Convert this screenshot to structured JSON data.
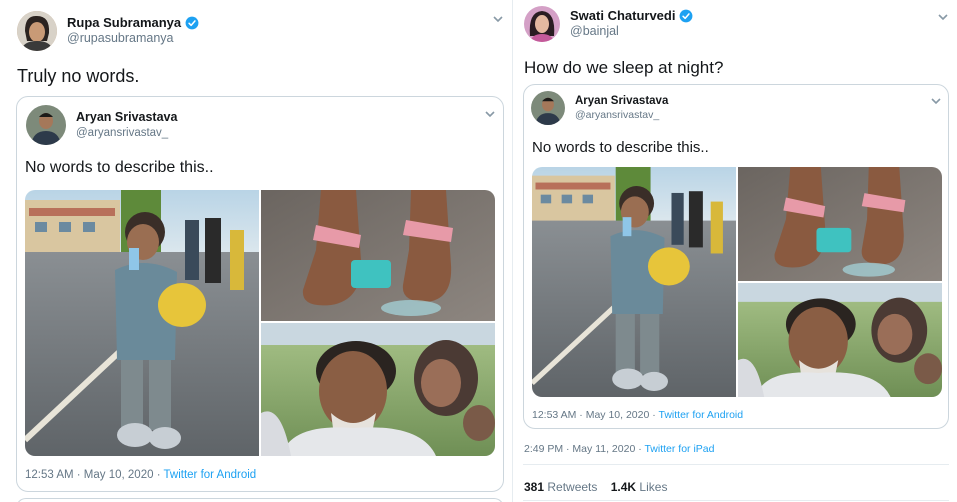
{
  "left_tweet": {
    "author_name": "Rupa Subramanya",
    "author_handle": "@rupasubramanya",
    "text": "Truly no words.",
    "quoted": {
      "author_name": "Aryan Srivastava",
      "author_handle": "@aryansrivastav_",
      "text": "No words to describe this..",
      "timestamp": "12:53 AM · May 10, 2020",
      "separator": " · ",
      "source": "Twitter for Android"
    }
  },
  "right_tweet": {
    "author_name": "Swati Chaturvedi",
    "author_handle": "@bainjal",
    "text": "How do we sleep at night?",
    "quoted": {
      "author_name": "Aryan Srivastava",
      "author_handle": "@aryansrivastav_",
      "text": "No words to describe this..",
      "timestamp": "12:53 AM · May 10, 2020",
      "separator": " · ",
      "source": "Twitter for Android"
    },
    "timestamp": "2:49 PM · May 11, 2020",
    "separator": " · ",
    "source": "Twitter for iPad",
    "retweets_count": "381",
    "retweets_label": " Retweets",
    "likes_count": "1.4K",
    "likes_label": " Likes"
  },
  "colors": {
    "link": "#1da1f2",
    "secondary_text": "#657786",
    "border": "#ccd6dd"
  },
  "icons": {
    "verified": "verified-badge-icon",
    "chevron": "chevron-down-icon"
  }
}
